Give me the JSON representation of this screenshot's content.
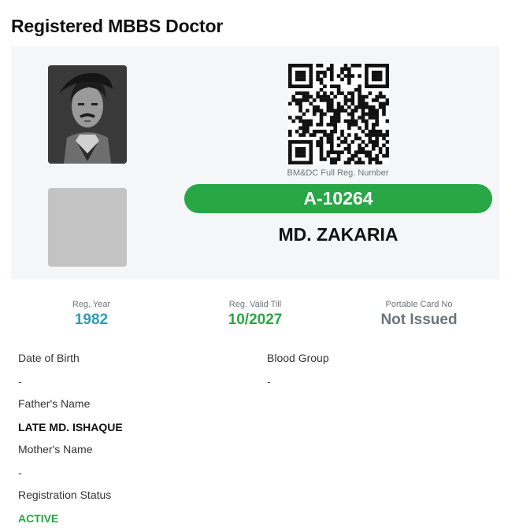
{
  "page": {
    "title": "Registered MBBS Doctor"
  },
  "card": {
    "qr_caption": "BM&DC Full Reg. Number",
    "reg_number": "A-10264",
    "doctor_name": "MD. ZAKARIA"
  },
  "stats": [
    {
      "label": "Reg. Year",
      "value": "1982",
      "color": "#2a9fb5"
    },
    {
      "label": "Reg. Valid Till",
      "value": "10/2027",
      "color": "#27a745"
    },
    {
      "label": "Portable Card No",
      "value": "Not Issued",
      "color": "#6c757d"
    }
  ],
  "details": {
    "dob": {
      "label": "Date of Birth",
      "value": "-"
    },
    "blood_group": {
      "label": "Blood Group",
      "value": "-"
    },
    "father": {
      "label": "Father's Name",
      "value": "LATE MD. ISHAQUE"
    },
    "mother": {
      "label": "Mother's Name",
      "value": "-"
    },
    "status": {
      "label": "Registration Status",
      "value": "ACTIVE",
      "color": "#27a745"
    }
  },
  "colors": {
    "accent_green": "#27a745",
    "accent_teal": "#2a9fb5",
    "muted": "#6c757d",
    "panel_bg": "#f5f6f7"
  }
}
